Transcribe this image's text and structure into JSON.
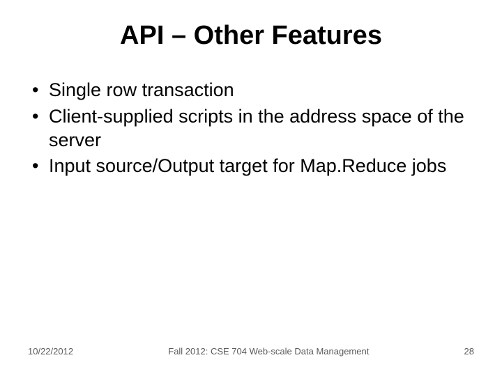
{
  "title": "API – Other Features",
  "bullets": [
    "Single row transaction",
    "Client-supplied scripts in the address space of the server",
    "Input source/Output target for Map.Reduce jobs"
  ],
  "footer": {
    "date": "10/22/2012",
    "course": "Fall 2012: CSE 704 Web-scale Data Management",
    "page": "28"
  }
}
